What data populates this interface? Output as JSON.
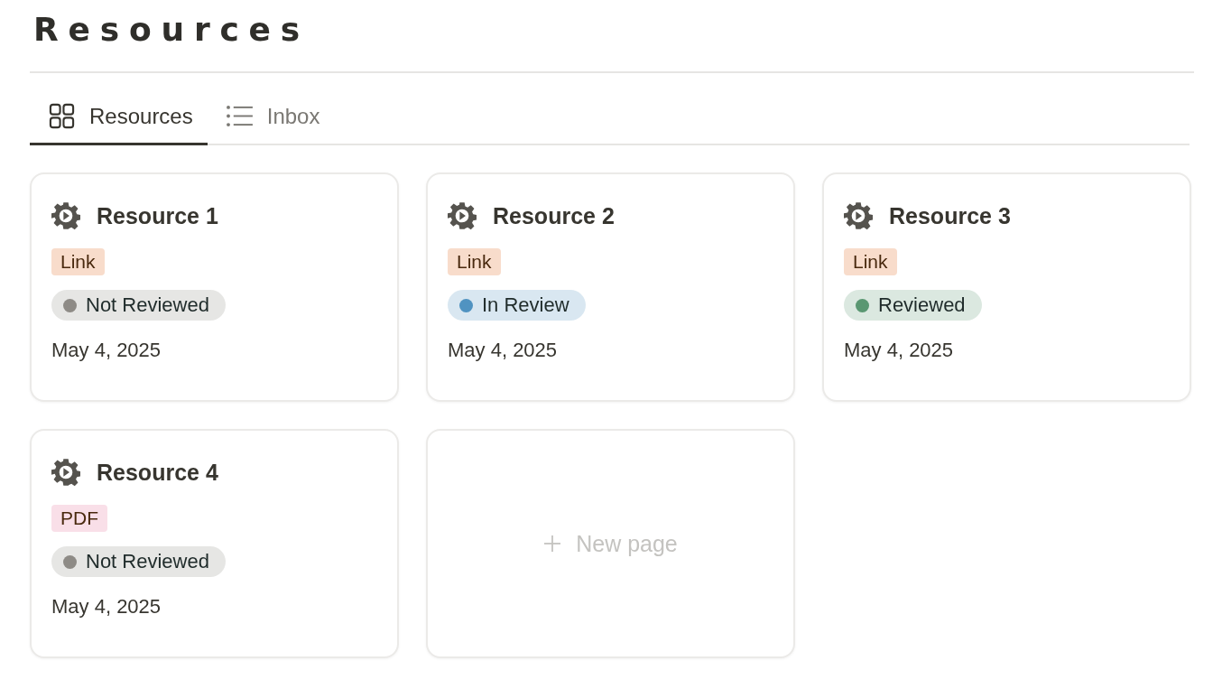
{
  "title": "Resources",
  "tabs": [
    {
      "label": "Resources",
      "kind": "grid",
      "selected": true
    },
    {
      "label": "Inbox",
      "kind": "list",
      "selected": false
    }
  ],
  "cards": [
    {
      "title": "Resource 1",
      "tag": {
        "label": "Link",
        "color": "#f8dccb"
      },
      "status": {
        "label": "Not Reviewed",
        "color": "#8e8b86"
      },
      "date": "May 4, 2025"
    },
    {
      "title": "Resource 2",
      "tag": {
        "label": "Link",
        "color": "#f8dccb"
      },
      "status": {
        "label": "In Review",
        "color": "#5093c1"
      },
      "date": "May 4, 2025"
    },
    {
      "title": "Resource 3",
      "tag": {
        "label": "Link",
        "color": "#f8dccb"
      },
      "status": {
        "label": "Reviewed",
        "color": "#5a9772"
      },
      "date": "May 4, 2025"
    },
    {
      "title": "Resource 4",
      "tag": {
        "label": "PDF",
        "color": "#f9dfe8"
      },
      "status": {
        "label": "Not Reviewed",
        "color": "#8e8b86"
      },
      "date": "May 4, 2025"
    }
  ],
  "new_page": {
    "label": "New page"
  }
}
